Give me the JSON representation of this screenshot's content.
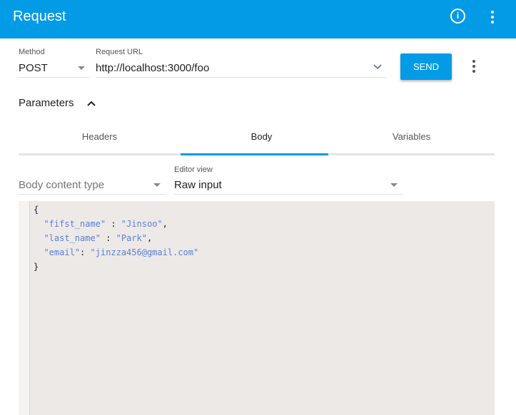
{
  "header": {
    "title": "Request",
    "info_icon": "i"
  },
  "request": {
    "method_label": "Method",
    "method": "POST",
    "url_label": "Request URL",
    "url": "http://localhost:3000/foo",
    "send_label": "SEND"
  },
  "parameters": {
    "label": "Parameters"
  },
  "tabs": [
    {
      "label": "Headers"
    },
    {
      "label": "Body"
    },
    {
      "label": "Variables"
    }
  ],
  "body": {
    "content_type_placeholder": "Body content type",
    "editor_view_label": "Editor view",
    "editor_view": "Raw input"
  },
  "editor": {
    "open": "{",
    "close": "}",
    "lines": [
      {
        "key": "\"fifst_name\"",
        "sep": " : ",
        "value": "\"Jinsoo\"",
        "end": ","
      },
      {
        "key": "\"last_name\"",
        "sep": " : ",
        "value": "\"Park\"",
        "end": ","
      },
      {
        "key": "\"email\"",
        "sep": ": ",
        "value": "\"jinzza456@gmail.com\"",
        "end": ""
      }
    ]
  },
  "colors": {
    "accent": "#039be5"
  }
}
